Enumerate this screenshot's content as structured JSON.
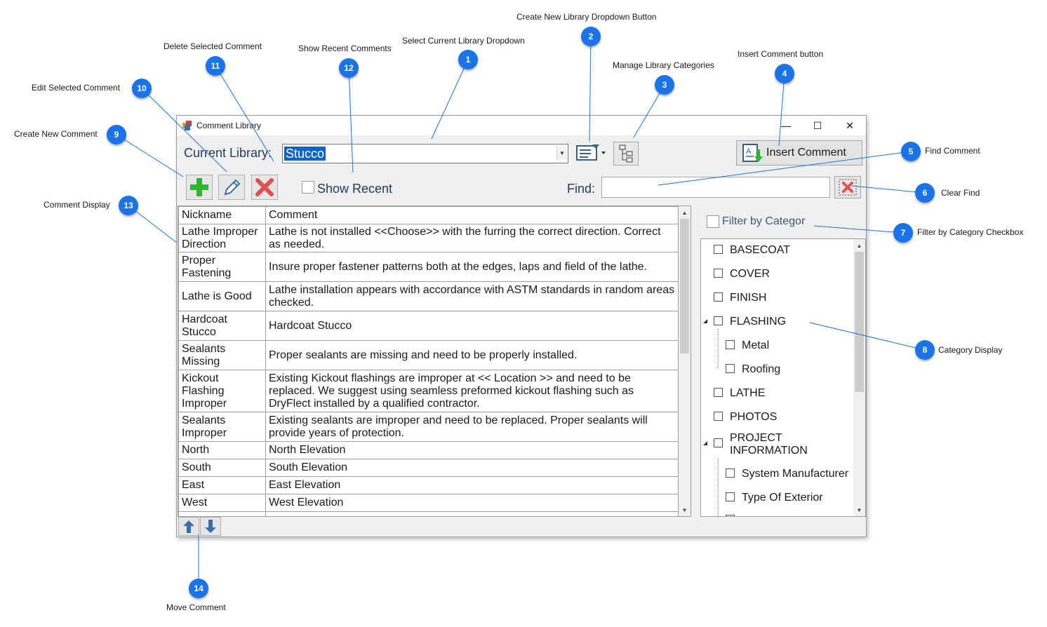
{
  "window": {
    "title": "Comment Library",
    "controls": {
      "minimize": "—",
      "maximize": "☐",
      "close": "✕"
    }
  },
  "toolbar": {
    "current_library_label": "Current Library:",
    "current_library_value": "Stucco",
    "insert_comment_label": "Insert Comment",
    "show_recent_label": "Show Recent",
    "find_label": "Find:",
    "find_value": "",
    "find_placeholder": ""
  },
  "grid": {
    "columns": [
      "Nickname",
      "Comment"
    ],
    "rows": [
      [
        "Lathe Improper Direction",
        "Lathe is not installed <<Choose>> with the furring the correct direction.  Correct as needed."
      ],
      [
        "Proper Fastening",
        "Insure proper fastener patterns both at the edges, laps and field of the lathe."
      ],
      [
        "Lathe is Good",
        "Lathe installation appears with accordance with ASTM standards in random areas checked."
      ],
      [
        "Hardcoat Stucco",
        "Hardcoat Stucco"
      ],
      [
        "Sealants Missing",
        "Proper sealants are missing and need to be properly installed."
      ],
      [
        "Kickout Flashing Improper",
        "Existing Kickout flashings are improper at << Location >> and need to be replaced.  We suggest using seamless preformed kickout flashing such as DryFlect installed by a qualified contractor."
      ],
      [
        "Sealants Improper",
        "Existing sealants are improper and need to be replaced.  Proper sealants will provide years of protection."
      ],
      [
        "North",
        "North Elevation"
      ],
      [
        "South",
        "South Elevation"
      ],
      [
        "East",
        "East Elevation"
      ],
      [
        "West",
        "West Elevation"
      ],
      [
        "",
        ""
      ]
    ]
  },
  "filter": {
    "label": "Filter by Categor",
    "checked": false
  },
  "categories": [
    {
      "label": "BASECOAT"
    },
    {
      "label": "COVER"
    },
    {
      "label": "FINISH"
    },
    {
      "label": "FLASHING"
    },
    {
      "label": "Metal"
    },
    {
      "label": "Roofing"
    },
    {
      "label": "LATHE"
    },
    {
      "label": "PHOTOS"
    },
    {
      "label": "PROJECT\nINFORMATION"
    },
    {
      "label": "System Manufacturer"
    },
    {
      "label": "Type Of Exterior"
    }
  ],
  "callouts": [
    {
      "num": "1",
      "text": "Select Current Library Dropdown"
    },
    {
      "num": "2",
      "text": "Create New Library Dropdown Button"
    },
    {
      "num": "3",
      "text": "Manage Library Categories"
    },
    {
      "num": "4",
      "text": "Insert Comment button"
    },
    {
      "num": "5",
      "text": "Find Comment"
    },
    {
      "num": "6",
      "text": "Clear Find"
    },
    {
      "num": "7",
      "text": "Filter by Category Checkbox"
    },
    {
      "num": "8",
      "text": "Category Display"
    },
    {
      "num": "9",
      "text": "Create New Comment"
    },
    {
      "num": "10",
      "text": "Edit Selected Comment"
    },
    {
      "num": "11",
      "text": "Delete Selected Comment"
    },
    {
      "num": "12",
      "text": "Show Recent Comments"
    },
    {
      "num": "13",
      "text": "Comment Display"
    },
    {
      "num": "14",
      "text": "Move Comment"
    }
  ],
  "icons": {
    "add": "plus-icon",
    "edit": "pencil-icon",
    "delete": "x-icon",
    "move_up": "arrow-up-icon",
    "move_down": "arrow-down-icon",
    "accent": "#1a73e8",
    "add_color": "#2fb52f",
    "delete_color": "#e05050"
  }
}
